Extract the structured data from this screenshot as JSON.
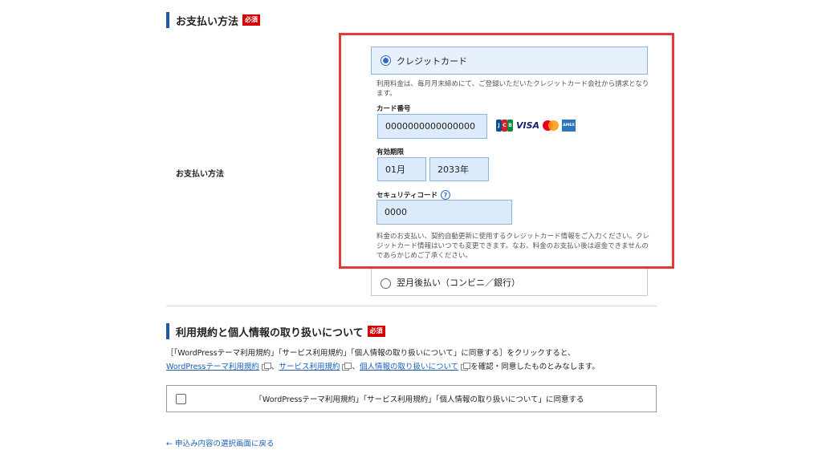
{
  "payment_section": {
    "heading": "お支払い方法",
    "required_badge": "必須",
    "row_label": "お支払い方法",
    "card_option": {
      "label": "クレジットカード",
      "selected": true,
      "note": "利用料金は、毎月月末締めにて、ご登録いただいたクレジットカード会社から請求となります。",
      "card_number_label": "カード番号",
      "card_number_value": "0000000000000000",
      "brand_logos": [
        "JCB",
        "VISA",
        "Mastercard",
        "AMEX"
      ],
      "jcb_colors": [
        "#0e4c96",
        "#d81e2b",
        "#0a8a3e"
      ],
      "expiry_label": "有効期限",
      "expiry_month": "01月",
      "expiry_year": "2033年",
      "cvc_label": "セキュリティコード",
      "cvc_help": "?",
      "cvc_value": "0000",
      "security_note": "料金のお支払い、契約自動更新に使用するクレジットカード情報をご入力ください。クレジットカード情報はいつでも変更できます。なお、料金のお支払い後は返金できませんのであらかじめご了承ください。"
    },
    "deferred_option": {
      "label": "翌月後払い（コンビニ／銀行）",
      "selected": false
    }
  },
  "terms_section": {
    "heading": "利用規約と個人情報の取り扱いについて",
    "required_badge": "必須",
    "intro": "［「WordPressテーマ利用規約」「サービス利用規約」「個人情報の取り扱いについて」に同意する］をクリックすると、",
    "links": [
      "WordPressテーマ利用規約",
      "サービス利用規約",
      "個人情報の取り扱いについて"
    ],
    "separator": "、",
    "outro": "を確認・同意したものとみなします。",
    "agree_label": "「WordPressテーマ利用規約」「サービス利用規約」「個人情報の取り扱いについて」に同意する",
    "agree_checked": false
  },
  "back_link": "← 申込み内容の選択画面に戻る",
  "colors": {
    "accent": "#1f5aa8",
    "required": "#d40000",
    "highlight_frame": "#e53935",
    "field_bg": "#dcebf9",
    "link": "#1a5fb4"
  }
}
